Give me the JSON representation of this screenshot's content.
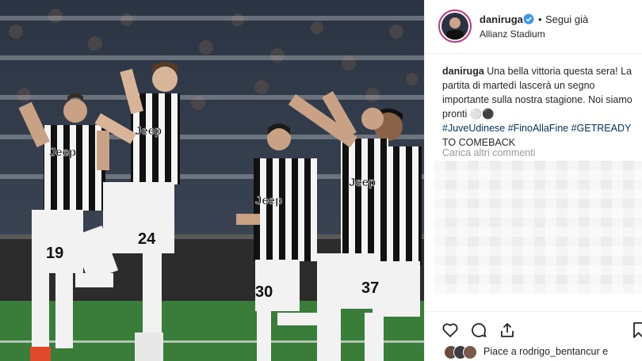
{
  "post": {
    "username": "daniruga",
    "follow_status": "Segui già",
    "location": "Allianz Stadium",
    "caption_user": "daniruga",
    "caption_text": "Una bella vittoria questa sera! La partita di martedì lascerà un segno importante sulla nostra stagione. Noi siamo pronti ⚪⚫",
    "hashtags": "#JuveUdinese #FinoAllaFine #GETREADY",
    "caption_tail": "TO COMEBACK",
    "load_more": "Carica altri commenti",
    "likes_text": "Piace a rodrigo_bentancur e"
  },
  "photo": {
    "jersey_numbers": [
      "19",
      "24",
      "30",
      "37"
    ],
    "sponsor": "Jeep"
  },
  "icons": [
    "verified-badge-icon",
    "heart-icon",
    "comment-icon",
    "share-icon",
    "bookmark-icon"
  ],
  "colors": {
    "verified": "#3897f0",
    "hashtag": "#003569",
    "muted": "#999999",
    "story_ring": "#c13584"
  }
}
